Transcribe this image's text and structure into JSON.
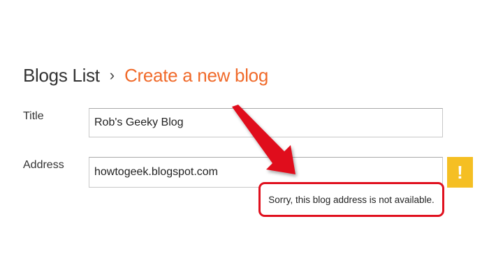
{
  "breadcrumb": {
    "root": "Blogs List",
    "separator": "›",
    "current": "Create a new blog"
  },
  "form": {
    "title_label": "Title",
    "title_value": "Rob's Geeky Blog",
    "address_label": "Address",
    "address_value": "howtogeek.blogspot.com",
    "warning_symbol": "!",
    "error_message": "Sorry, this blog address is not available."
  },
  "colors": {
    "breadcrumb_accent": "#f06a2a",
    "warning_badge": "#f5bf23",
    "annotation_red": "#e0101e"
  },
  "icons": {
    "warning": "warning-icon",
    "annotation": "arrow-annotation-icon"
  }
}
